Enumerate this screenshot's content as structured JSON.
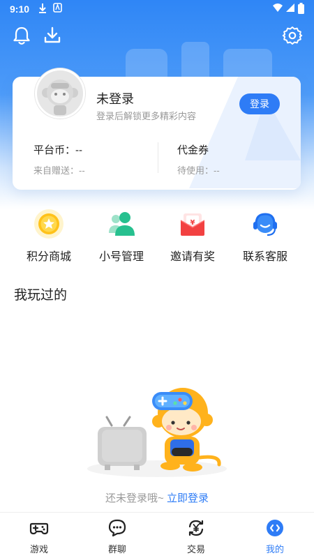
{
  "status_bar": {
    "time": "9:10"
  },
  "header": {
    "bell_icon": "bell-icon",
    "download_icon": "download-icon",
    "settings_icon": "gear-icon"
  },
  "profile": {
    "name": "未登录",
    "subtitle": "登录后解锁更多精彩内容",
    "login_label": "登录",
    "coin_label": "平台币：--",
    "coin_sub": "来自赠送：--",
    "voucher_label": "代金券",
    "voucher_sub": "待使用：--"
  },
  "features": [
    {
      "label": "积分商城",
      "icon": "star-coin-icon"
    },
    {
      "label": "小号管理",
      "icon": "users-icon"
    },
    {
      "label": "邀请有奖",
      "icon": "red-envelope-icon"
    },
    {
      "label": "联系客服",
      "icon": "headset-icon"
    }
  ],
  "played": {
    "title": "我玩过的",
    "empty_text": "还未登录哦~",
    "empty_link": "立即登录"
  },
  "tabs": [
    {
      "label": "游戏",
      "icon": "gamepad-icon",
      "active": false
    },
    {
      "label": "群聊",
      "icon": "chat-icon",
      "active": false
    },
    {
      "label": "交易",
      "icon": "yen-exchange-icon",
      "active": false
    },
    {
      "label": "我的",
      "icon": "profile-icon",
      "active": true
    }
  ],
  "colors": {
    "primary": "#2e7cf6",
    "header_gradient_top": "#2f86f6",
    "muted_text": "#999999"
  }
}
